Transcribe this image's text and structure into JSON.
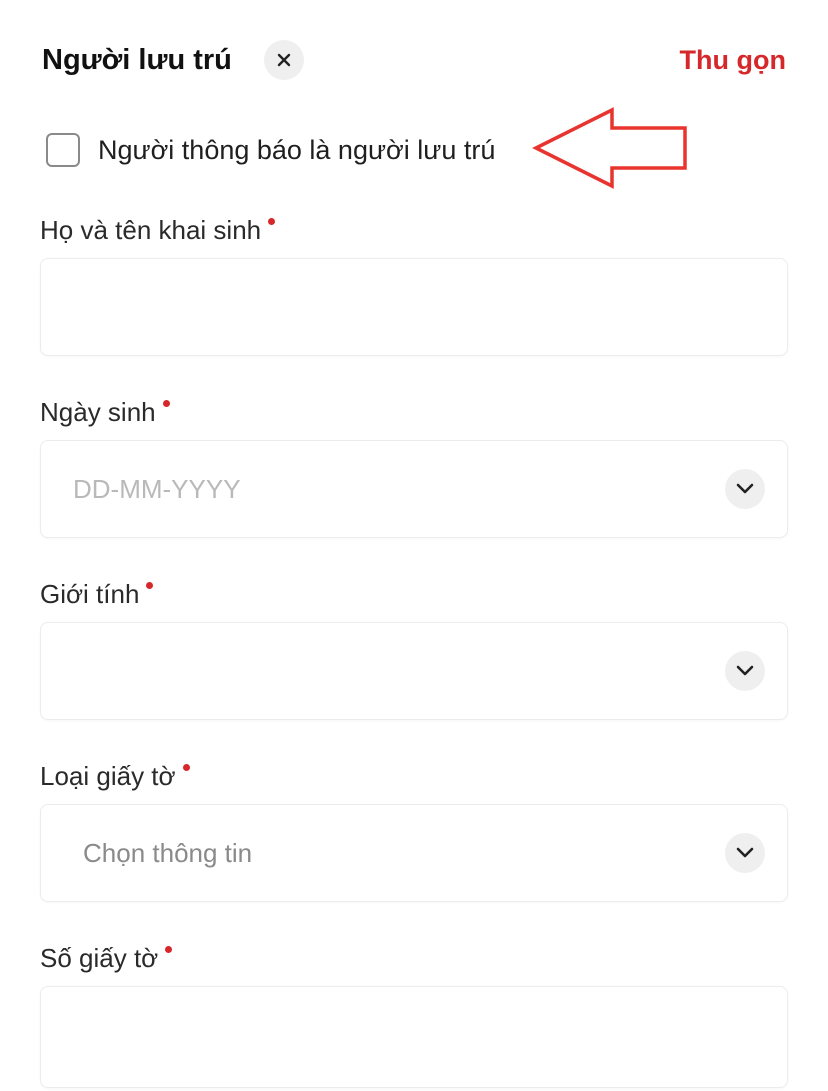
{
  "header": {
    "title": "Người lưu trú",
    "close_icon": "close-icon",
    "collapse_label": "Thu gọn"
  },
  "checkbox": {
    "label": "Người thông báo là người lưu trú",
    "checked": false
  },
  "fields": [
    {
      "label": "Họ và tên khai sinh",
      "required": true,
      "type": "text",
      "value": "",
      "placeholder": ""
    },
    {
      "label": "Ngày sinh",
      "required": true,
      "type": "date-select",
      "value": "",
      "placeholder": "DD-MM-YYYY",
      "icon": "chevron-down-icon"
    },
    {
      "label": "Giới tính",
      "required": true,
      "type": "select",
      "value": "",
      "placeholder": "",
      "icon": "chevron-down-icon"
    },
    {
      "label": "Loại giấy tờ",
      "required": true,
      "type": "select",
      "value": "",
      "placeholder": "Chọn thông tin",
      "icon": "chevron-down-icon"
    },
    {
      "label": "Số giấy tờ",
      "required": true,
      "type": "text",
      "value": "",
      "placeholder": ""
    }
  ],
  "colors": {
    "accent_red": "#d6282b",
    "annotation_arrow": "#e8332f",
    "chevron_bg": "#efefef"
  }
}
